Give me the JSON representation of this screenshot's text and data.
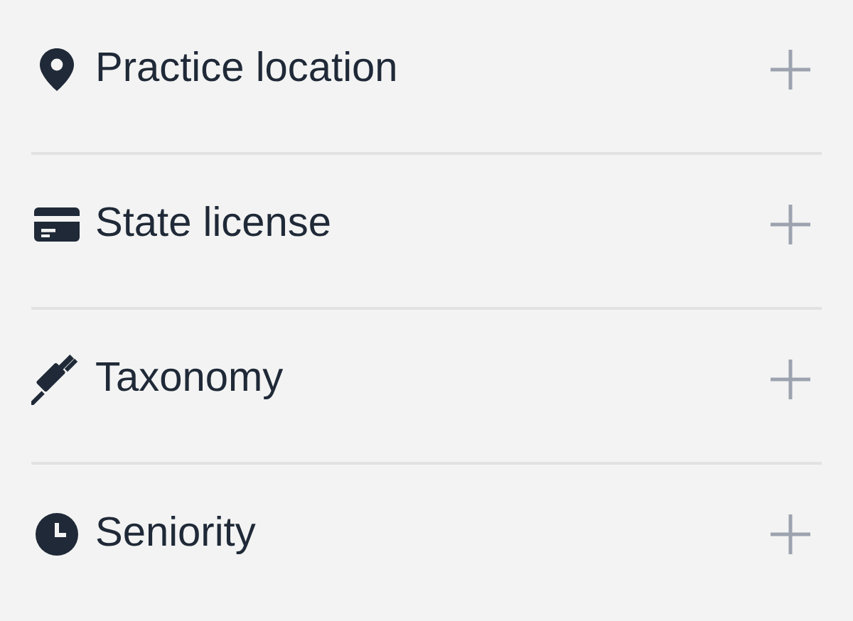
{
  "sections": [
    {
      "label": "Practice location",
      "expanded": false
    },
    {
      "label": "State license",
      "expanded": false
    },
    {
      "label": "Taxonomy",
      "expanded": false
    },
    {
      "label": "Seniority",
      "expanded": false
    }
  ]
}
